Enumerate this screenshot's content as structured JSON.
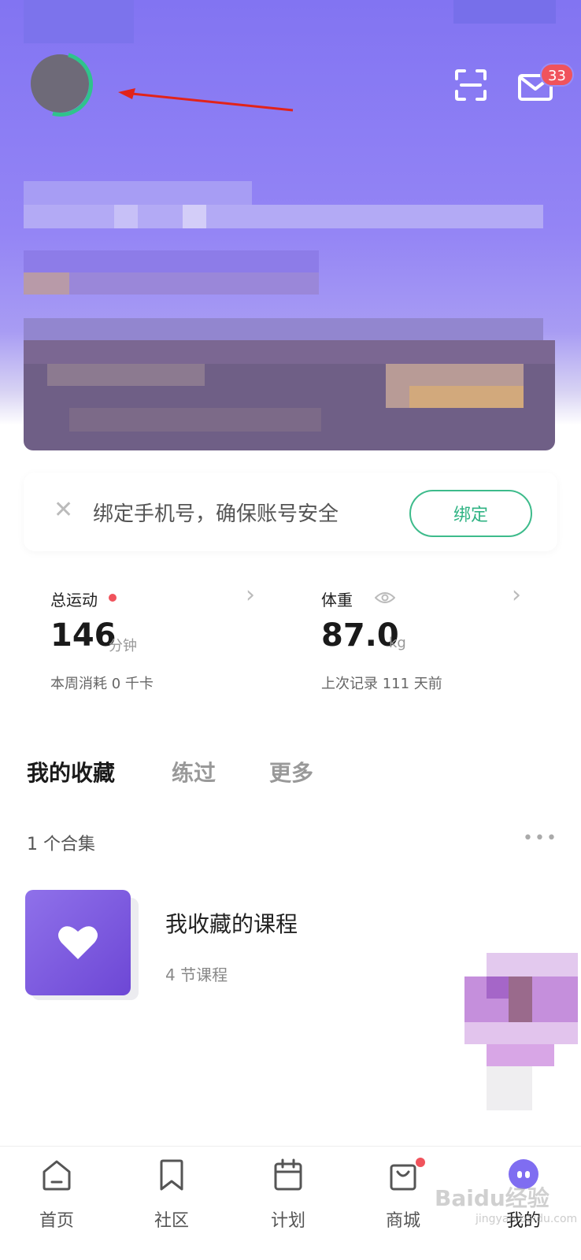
{
  "header": {
    "notification_count": "33",
    "icons": [
      "scan-icon",
      "mail-icon"
    ]
  },
  "bind_banner": {
    "text": "绑定手机号，确保账号安全",
    "button": "绑定",
    "close_icon": "✕"
  },
  "stats": {
    "exercise": {
      "title": "总运动",
      "value": "146",
      "unit": "分钟",
      "subtitle": "本周消耗 0 千卡"
    },
    "weight": {
      "title": "体重",
      "value": "87.0",
      "unit": "kg",
      "subtitle": "上次记录 111 天前"
    }
  },
  "tabs": [
    "我的收藏",
    "练过",
    "更多"
  ],
  "collection": {
    "count_text": "1 个合集",
    "more": "•••",
    "items": [
      {
        "title": "我收藏的课程",
        "subtitle": "4 节课程"
      }
    ]
  },
  "bottom_nav": [
    {
      "label": "首页",
      "icon": "home-icon"
    },
    {
      "label": "社区",
      "icon": "bookmark-icon"
    },
    {
      "label": "计划",
      "icon": "calendar-icon"
    },
    {
      "label": "商城",
      "icon": "shop-bag-icon"
    },
    {
      "label": "我的",
      "icon": "me-face-icon"
    }
  ],
  "watermark": {
    "text": "Baidu经验",
    "sub": "jingyan.baidu.com"
  },
  "colors": {
    "accent_green": "#2fb383",
    "hero_purple": "#8274f2",
    "badge_red": "#f0535c",
    "course_purple": "#7a58de"
  }
}
